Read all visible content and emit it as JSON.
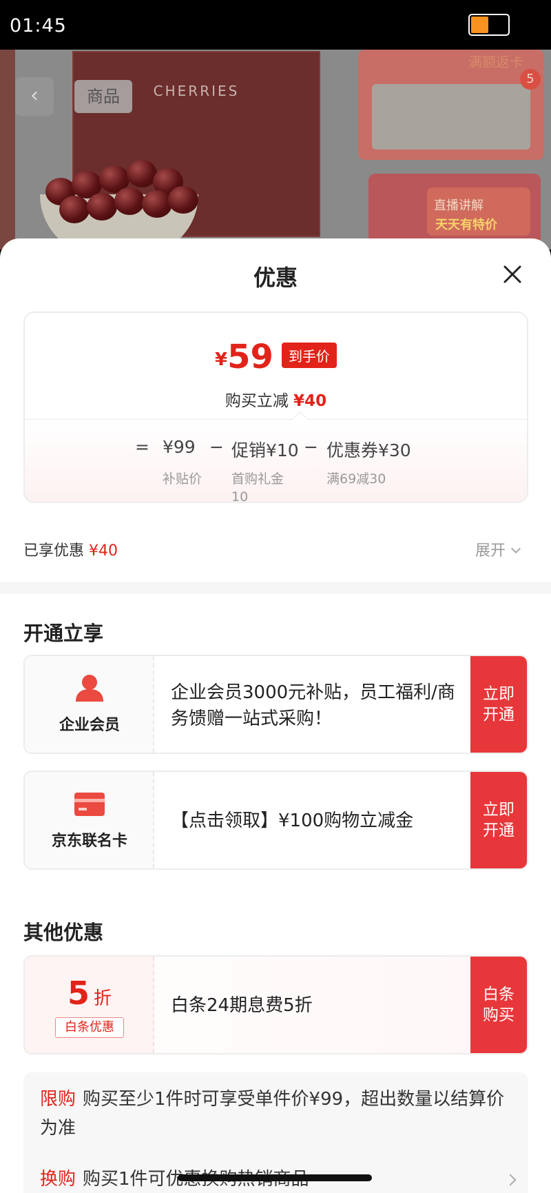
{
  "status_bar": {
    "time": "01:45",
    "battery_level_percent": 45,
    "battery_color": "#f7931e"
  },
  "backdrop": {
    "tab_label": "商品",
    "box_brand": "CHERRIES",
    "panel_tag": "满额返卡",
    "badge_count": "5",
    "live_label": "直播讲解",
    "live_slogan": "天天有特价"
  },
  "sheet": {
    "title": "优惠"
  },
  "price_card": {
    "currency": "¥",
    "final_price": "59",
    "final_price_tag": "到手价",
    "instant_discount_label": "购买立减",
    "instant_discount_value": "¥40",
    "equals_sign": "=",
    "minus_sign": "−",
    "calc": [
      {
        "amount": "¥99",
        "note": "补贴价"
      },
      {
        "amount": "促销¥10",
        "note": "首购礼金 10"
      },
      {
        "amount": "优惠券¥30",
        "note": "满69减30"
      }
    ]
  },
  "summary": {
    "enjoyed_label": "已享优惠",
    "enjoyed_value": "¥40",
    "expand_label": "展开"
  },
  "open_section": {
    "title": "开通立享",
    "offers": [
      {
        "label": "企业会员",
        "icon": "user-icon",
        "text": "企业会员3000元补贴，员工福利/商务馈赠一站式采购！",
        "button": "立即开通"
      },
      {
        "label": "京东联名卡",
        "icon": "card-icon",
        "text": "【点击领取】¥100购物立减金",
        "button": "立即开通"
      }
    ]
  },
  "other_section": {
    "title": "其他优惠",
    "offers": [
      {
        "discount_number": "5",
        "discount_unit": "折",
        "tag": "白条优惠",
        "text": "白条24期息费5折",
        "button": "白条购买"
      }
    ]
  },
  "limits": [
    {
      "tag": "限购",
      "text": "购买至少1件时可享受单件价¥99，超出数量以结算价为准"
    },
    {
      "tag": "换购",
      "text": "购买1件可优惠换购热销商品"
    }
  ],
  "colors": {
    "accent": "#e2231a",
    "button_red": "#e8373a"
  }
}
